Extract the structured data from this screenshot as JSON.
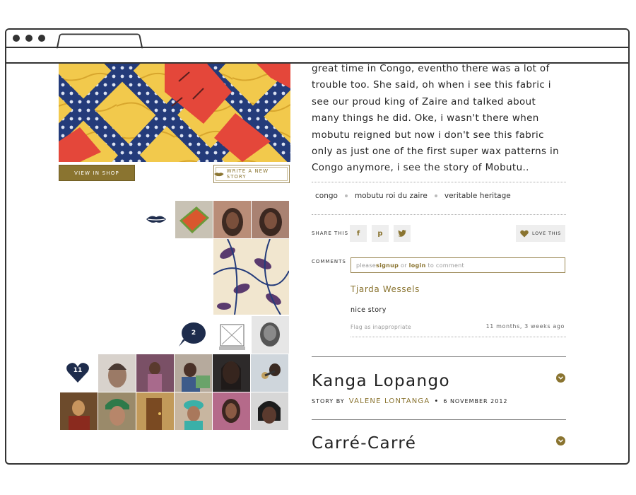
{
  "left": {
    "view_in_shop": "VIEW IN SHOP",
    "write_story": "WRITE A NEW STORY",
    "comment_count": "2",
    "love_count": "11"
  },
  "story": {
    "lines": [
      "great time in Congo, eventho there was a lot of",
      "trouble too. She said, oh when i see this fabric i",
      "see our proud king of Zaire and talked about",
      "many things he did. Oke, i wasn't there when",
      "mobutu reigned but now i don't see this fabric",
      "only as just one of the first super wax patterns in",
      "Congo anymore, i see the story of Mobutu.."
    ],
    "tags": [
      "congo",
      "mobutu roi du zaire",
      "veritable heritage"
    ]
  },
  "share": {
    "label": "SHARE THIS",
    "facebook": "f",
    "pinterest": "p",
    "love_label": "LOVE THIS"
  },
  "comments": {
    "label": "COMMENTS",
    "placeholder_pre": "please ",
    "signup": "signup",
    "or": " or ",
    "login": "login",
    "placeholder_post": " to comment",
    "items": [
      {
        "author": "Tjarda Wessels",
        "text": "nice story",
        "flag": "Flag as inappropriate",
        "ago": "11 months, 3 weeks ago"
      }
    ]
  },
  "stories": [
    {
      "title": "Kanga Lopango",
      "by_label": "STORY BY",
      "author": "VALENE LONTANGA",
      "date": "6 NOVEMBER 2012"
    },
    {
      "title": "Carré-Carré"
    }
  ],
  "colors": {
    "accent": "#8a7430",
    "navy": "#1e2c4c"
  }
}
